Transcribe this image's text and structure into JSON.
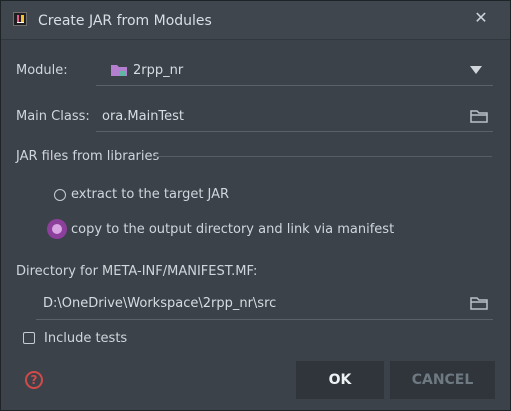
{
  "window": {
    "title": "Create JAR from Modules",
    "app_icon": "intellij-icon",
    "close_icon": "close-icon"
  },
  "module": {
    "label": "Module:",
    "value": "2rpp_nr",
    "icon": "module-folder-icon",
    "dropdown_icon": "chevron-down-icon"
  },
  "main_class": {
    "label": "Main Class:",
    "value": "ora.MainTest",
    "browse_icon": "folder-icon"
  },
  "libraries": {
    "section_title": "JAR files from libraries",
    "options": [
      {
        "label": "extract to the target JAR",
        "selected": false
      },
      {
        "label": "copy to the output directory and link via manifest",
        "selected": true
      }
    ]
  },
  "manifest_dir": {
    "label": "Directory for META-INF/MANIFEST.MF:",
    "value": "D:\\OneDrive\\Workspace\\2rpp_nr\\src",
    "browse_icon": "folder-icon"
  },
  "include_tests": {
    "label": "Include tests",
    "checked": false
  },
  "footer": {
    "help_icon": "help-icon",
    "ok_label": "OK",
    "cancel_label": "CANCEL"
  },
  "colors": {
    "accent_radio": "#8d3f9c",
    "help_red": "#d04a4a",
    "background": "#3c4249"
  }
}
